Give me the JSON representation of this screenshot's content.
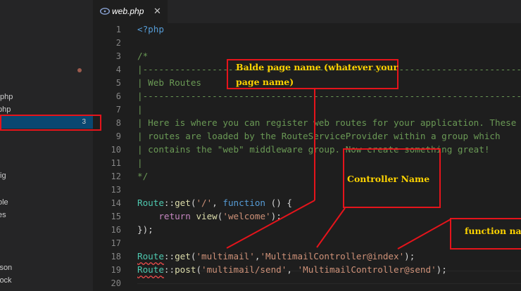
{
  "sidebar": {
    "items": [
      {
        "label": ".php"
      },
      {
        "label": "php"
      },
      {
        "label": "",
        "badge": "3"
      },
      {
        "label": "fig"
      },
      {
        "label": "ole"
      },
      {
        "label": "es"
      },
      {
        "label": "l"
      },
      {
        "label": "json"
      },
      {
        "label": "lock"
      }
    ]
  },
  "tab": {
    "label": "web.php",
    "close": "✕"
  },
  "editor": {
    "line_numbers": [
      "1",
      "2",
      "3",
      "4",
      "5",
      "6",
      "7",
      "8",
      "9",
      "10",
      "11",
      "12",
      "13",
      "14",
      "15",
      "16",
      "17",
      "18",
      "19",
      "20"
    ],
    "lines": {
      "l1": "<?php",
      "l3": "/*",
      "l4": "|--------------------------------------------------------------------------",
      "l5": "| Web Routes",
      "l6": "|--------------------------------------------------------------------------",
      "l7": "|",
      "l8": "| Here is where you can register web routes for your application. These",
      "l9": "| routes are loaded by the RouteServiceProvider within a group which",
      "l10": "| contains the \"web\" middleware group. Now create something great!",
      "l11": "|",
      "l12": "*/",
      "l14_route": "Route",
      "l14_sep": "::",
      "l14_get": "get",
      "l14_p1": "(",
      "l14_str": "'/'",
      "l14_comma": ", ",
      "l14_fn": "function",
      "l14_rest": " () {",
      "l15_indent": "    ",
      "l15_return": "return",
      "l15_sp": " ",
      "l15_view": "view",
      "l15_p1": "(",
      "l15_str": "'welcome'",
      "l15_p2": ");",
      "l16": "});",
      "l18_route": "Route",
      "l18_sep": "::",
      "l18_get": "get",
      "l18_p1": "(",
      "l18_str1": "'multimail'",
      "l18_comma": ",",
      "l18_str2": "'MultimailController@index'",
      "l18_p2": ");",
      "l19_route": "Route",
      "l19_sep": "::",
      "l19_post": "post",
      "l19_p1": "(",
      "l19_str1": "'multimail/send'",
      "l19_comma": ", ",
      "l19_str2": "'MultimailController@send'",
      "l19_p2": ");"
    }
  },
  "annotations": {
    "blade_line1": "Balde page name (whatever your",
    "blade_line2": "page name)",
    "controller": "Controller    Name",
    "function": "function nam"
  },
  "colors": {
    "annotation_border": "#e5141b",
    "annotation_text": "#ffd400",
    "selection": "#094771"
  }
}
